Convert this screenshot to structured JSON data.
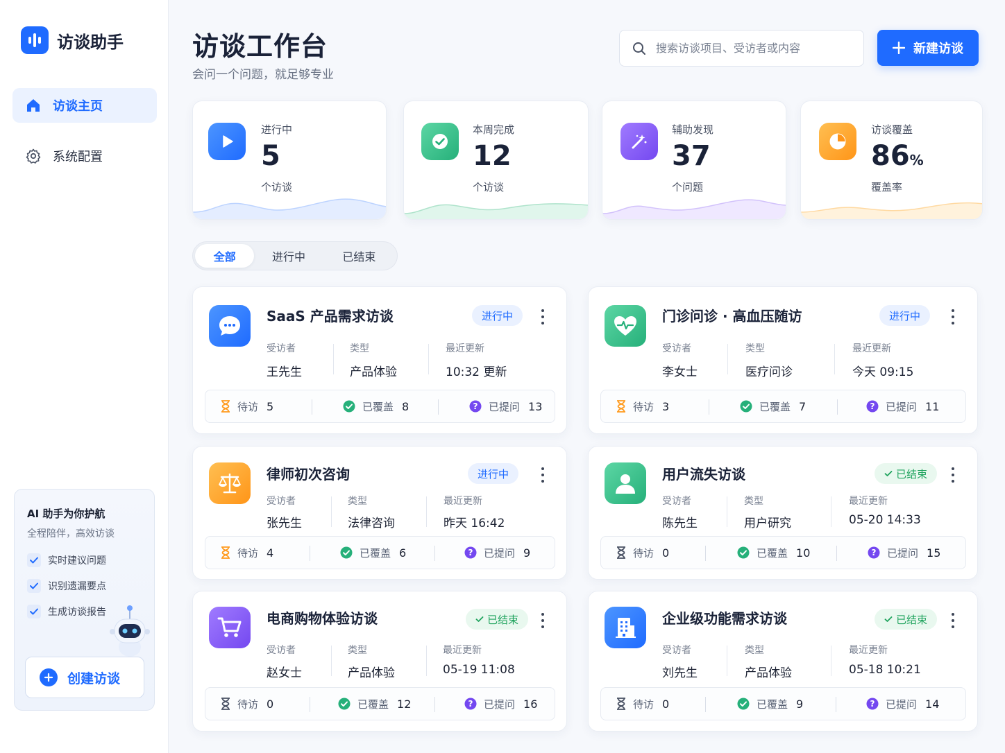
{
  "brand": {
    "name": "访谈助手"
  },
  "sidebar": {
    "items": [
      {
        "label": "访谈主页",
        "active": true
      },
      {
        "label": "系统配置",
        "active": false
      }
    ]
  },
  "assistant": {
    "title": "AI 助手为你护航",
    "subtitle": "全程陪伴，高效访谈",
    "features": [
      "实时建议问题",
      "识别遗漏要点",
      "生成访谈报告"
    ],
    "create_label": "创建访谈"
  },
  "header": {
    "title": "访谈工作台",
    "subtitle": "会问一个问题，就足够专业",
    "search_placeholder": "搜索访谈项目、受访者或内容",
    "new_label": "新建访谈"
  },
  "stats": [
    {
      "label": "进行中",
      "value": "5",
      "suffix": "",
      "unit": "个访谈",
      "color": "#2f80ff"
    },
    {
      "label": "本周完成",
      "value": "12",
      "suffix": "",
      "unit": "个访谈",
      "color": "#33bf8a"
    },
    {
      "label": "辅助发现",
      "value": "37",
      "suffix": "",
      "unit": "个问题",
      "color": "#8a5cf6"
    },
    {
      "label": "访谈覆盖",
      "value": "86",
      "suffix": "%",
      "unit": "覆盖率",
      "color": "#ffa32b"
    }
  ],
  "tabs": [
    {
      "label": "全部",
      "active": true
    },
    {
      "label": "进行中",
      "active": false
    },
    {
      "label": "已结束",
      "active": false
    }
  ],
  "meta_labels": {
    "interviewee": "受访者",
    "type": "类型",
    "updated": "最近更新"
  },
  "stat_labels": {
    "pending": "待访",
    "covered": "已覆盖",
    "asked": "已提问"
  },
  "status_labels": {
    "ongoing": "进行中",
    "done": "已结束"
  },
  "cards": [
    {
      "title": "SaaS 产品需求访谈",
      "status": "进行中",
      "interviewee": "王先生",
      "type": "产品体验",
      "updated": "10:32 更新",
      "pending": "5",
      "covered": "8",
      "asked": "13",
      "icon": "chat-bubble-icon",
      "color": "#2f80ff"
    },
    {
      "title": "门诊问诊 · 高血压随访",
      "status": "进行中",
      "interviewee": "李女士",
      "type": "医疗问诊",
      "updated": "今天 09:15",
      "pending": "3",
      "covered": "7",
      "asked": "11",
      "icon": "heart-pulse-icon",
      "color": "#33bf8a"
    },
    {
      "title": "律师初次咨询",
      "status": "进行中",
      "interviewee": "张先生",
      "type": "法律咨询",
      "updated": "昨天 16:42",
      "pending": "4",
      "covered": "6",
      "asked": "9",
      "icon": "scales-icon",
      "color": "#ffa32b"
    },
    {
      "title": "用户流失访谈",
      "status": "已结束",
      "interviewee": "陈先生",
      "type": "用户研究",
      "updated": "05-20 14:33",
      "pending": "0",
      "covered": "10",
      "asked": "15",
      "icon": "user-icon",
      "color": "#33bf8a"
    },
    {
      "title": "电商购物体验访谈",
      "status": "已结束",
      "interviewee": "赵女士",
      "type": "产品体验",
      "updated": "05-19 11:08",
      "pending": "0",
      "covered": "12",
      "asked": "16",
      "icon": "cart-icon",
      "color": "#8a5cf6"
    },
    {
      "title": "企业级功能需求访谈",
      "status": "已结束",
      "interviewee": "刘先生",
      "type": "产品体验",
      "updated": "05-18 10:21",
      "pending": "0",
      "covered": "9",
      "asked": "14",
      "icon": "building-icon",
      "color": "#2f80ff"
    }
  ]
}
